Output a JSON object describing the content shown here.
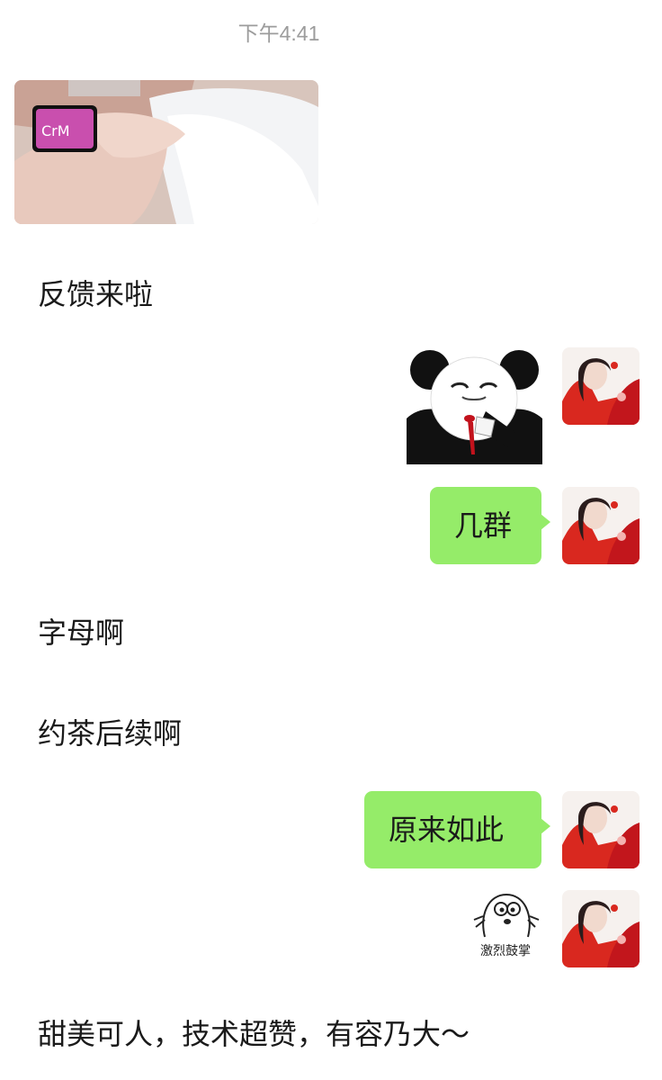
{
  "chat": {
    "timestamp": "下午4:41",
    "messages": [
      {
        "type": "image",
        "side": "left"
      },
      {
        "type": "text",
        "side": "left",
        "text": "反馈来啦"
      },
      {
        "type": "sticker",
        "side": "right",
        "icon": "panda-meme-sticker"
      },
      {
        "type": "text",
        "side": "right",
        "text": "几群"
      },
      {
        "type": "text",
        "side": "left",
        "text": "字母啊"
      },
      {
        "type": "text",
        "side": "left",
        "text": "约茶后续啊"
      },
      {
        "type": "text",
        "side": "right",
        "text": "原来如此"
      },
      {
        "type": "sticker",
        "side": "right",
        "icon": "clapping-sticker",
        "caption": "激烈鼓掌"
      },
      {
        "type": "text",
        "side": "left",
        "text": "甜美可人，技术超赞，有容乃大～"
      }
    ]
  },
  "colors": {
    "self_bubble": "#95ec69",
    "background": "#ffffff",
    "timestamp": "#9c9c9c"
  }
}
